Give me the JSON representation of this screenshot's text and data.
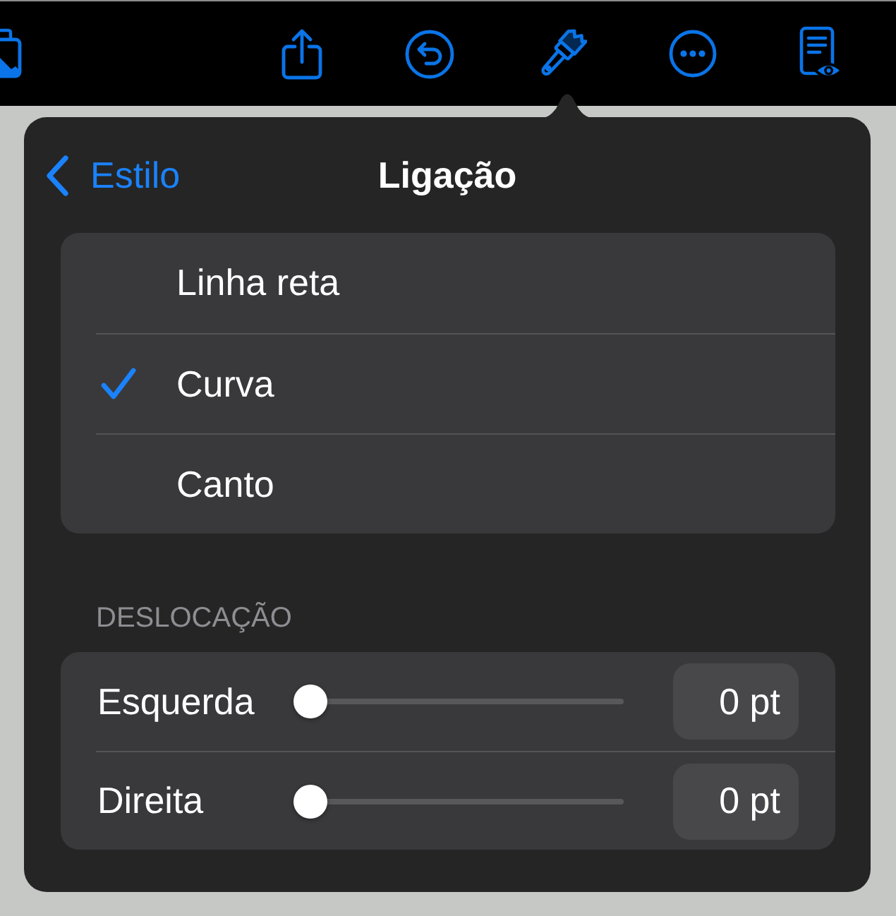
{
  "popover": {
    "back_button": "Estilo",
    "title": "Ligação"
  },
  "connection_types": [
    {
      "label": "Linha reta",
      "selected": false
    },
    {
      "label": "Curva",
      "selected": true
    },
    {
      "label": "Canto",
      "selected": false
    }
  ],
  "offset": {
    "heading": "DESLOCAÇÃO",
    "sliders": [
      {
        "label": "Esquerda",
        "level": 0,
        "value": "0 pt"
      },
      {
        "label": "Direita",
        "level": 0,
        "value": "0 pt"
      }
    ]
  }
}
